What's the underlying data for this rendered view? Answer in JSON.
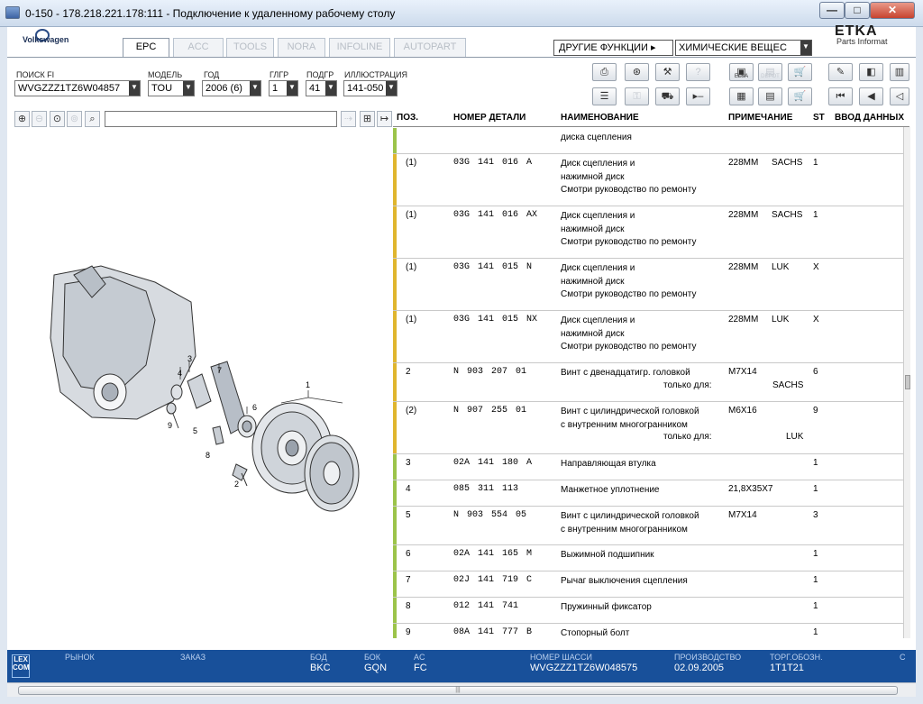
{
  "window": {
    "title": "0-150 - 178.218.221.178:111 - Подключение к удаленному рабочему столу",
    "minimize": "—",
    "maximize": "□",
    "close": "✕"
  },
  "brand": {
    "name": "Volkswagen",
    "etka": "ETKA",
    "etka_sub": "Parts Informat"
  },
  "tabs": [
    {
      "label": "EPC",
      "active": true
    },
    {
      "label": "ACC",
      "active": false
    },
    {
      "label": "TOOLS",
      "active": false
    },
    {
      "label": "NORA",
      "active": false
    },
    {
      "label": "INFOLINE",
      "active": false
    },
    {
      "label": "AUTOPART",
      "active": false
    }
  ],
  "functions": {
    "menu_label": "ДРУГИЕ ФУНКЦИИ ▸",
    "selected": "ХИМИЧЕСКИЕ ВЕЩЕС"
  },
  "filters": {
    "search_label": "ПОИСК FI",
    "search_value": "WVGZZZ1TZ6W04857",
    "model_label": "МОДЕЛЬ",
    "model_value": "TOU",
    "year_label": "ГОД",
    "year_value": "2006 (6)",
    "mgroup_label": "ГЛГР",
    "mgroup_value": "1",
    "subgroup_label": "ПОДГР",
    "subgroup_value": "41",
    "illustration_label": "ИЛЛЮСТРАЦИЯ",
    "illustration_value": "141-050"
  },
  "toolbar_icons": {
    "elsa": "ELSA",
    "depot": "DEPOT"
  },
  "illustration": {
    "callouts": [
      "1",
      "2",
      "3",
      "4",
      "5",
      "6",
      "7",
      "8",
      "9"
    ]
  },
  "table": {
    "headers": {
      "pos": "ПОЗ.",
      "part": "НОМЕР ДЕТАЛИ",
      "name": "НАИМЕНОВАНИЕ",
      "note": "ПРИМЕЧАНИЕ",
      "st": "ST",
      "input": "ВВОД ДАННЫХ"
    },
    "rows": [
      {
        "pos": "",
        "part": "",
        "name": [
          "диска сцепления"
        ],
        "note": "",
        "note2": "",
        "st": "",
        "bar": "#9cc44a",
        "h": 29
      },
      {
        "pos": "(1)",
        "part": "03G 141 016 A",
        "name": [
          "Диск сцепления и",
          "нажимной диск",
          "Смотри руководство по ремонту"
        ],
        "note": "228MM",
        "note2": "SACHS",
        "st": "1",
        "bar": "#e0b62e",
        "h": 58
      },
      {
        "pos": "(1)",
        "part": "03G 141 016 AX",
        "name": [
          "Диск сцепления и",
          "нажимной диск",
          "Смотри руководство по ремонту"
        ],
        "note": "228MM",
        "note2": "SACHS",
        "st": "1",
        "bar": "#e0b62e",
        "h": 58
      },
      {
        "pos": "(1)",
        "part": "03G 141 015 N",
        "name": [
          "Диск сцепления и",
          "нажимной диск",
          "Смотри руководство по ремонту"
        ],
        "note": "228MM",
        "note2": "LUK",
        "st": "X",
        "bar": "#e0b62e",
        "h": 58
      },
      {
        "pos": "(1)",
        "part": "03G 141 015 NX",
        "name": [
          "Диск сцепления и",
          "нажимной диск",
          "Смотри руководство по ремонту"
        ],
        "note": "228MM",
        "note2": "LUK",
        "st": "X",
        "bar": "#e0b62e",
        "h": 58
      },
      {
        "pos": "2",
        "part": "N 903 207 01",
        "name": [
          "Винт с двенадцатигр. головкой"
        ],
        "sub_label": "только для:",
        "sub_value": "SACHS",
        "note": "M7X14",
        "note2": "",
        "st": "6",
        "bar": "#e0b62e",
        "h": 43
      },
      {
        "pos": "(2)",
        "part": "N 907 255 01",
        "name": [
          "Винт с цилиндрической головкой",
          "с внутренним многогранником"
        ],
        "sub_label": "только для:",
        "sub_value": "LUK",
        "note": "M6X16",
        "note2": "",
        "st": "9",
        "bar": "#e0b62e",
        "h": 58
      },
      {
        "pos": "3",
        "part": "02A 141 180 A",
        "name": [
          "Направляющая втулка"
        ],
        "note": "",
        "note2": "",
        "st": "1",
        "bar": "#9cc44a",
        "h": 29
      },
      {
        "pos": "4",
        "part": "085 311 113",
        "name": [
          "Манжетное уплотнение"
        ],
        "note": "21,8X35X7",
        "note2": "",
        "st": "1",
        "bar": "#9cc44a",
        "h": 29
      },
      {
        "pos": "5",
        "part": "N 903 554 05",
        "name": [
          "Винт с цилиндрической головкой",
          "с внутренним многогранником"
        ],
        "note": "M7X14",
        "note2": "",
        "st": "3",
        "bar": "#9cc44a",
        "h": 43
      },
      {
        "pos": "6",
        "part": "02A 141 165 M",
        "name": [
          "Выжимной подшипник"
        ],
        "note": "",
        "note2": "",
        "st": "1",
        "bar": "#9cc44a",
        "h": 29
      },
      {
        "pos": "7",
        "part": "02J 141 719 C",
        "name": [
          "Рычаг выключения сцепления"
        ],
        "note": "",
        "note2": "",
        "st": "1",
        "bar": "#9cc44a",
        "h": 29
      },
      {
        "pos": "8",
        "part": "012 141 741",
        "name": [
          "Пружинный фиксатор"
        ],
        "note": "",
        "note2": "",
        "st": "1",
        "bar": "#9cc44a",
        "h": 29
      },
      {
        "pos": "9",
        "part": "08A 141 777 B",
        "name": [
          "Стопорный болт"
        ],
        "note": "",
        "note2": "",
        "st": "1",
        "bar": "#9cc44a",
        "h": 29
      }
    ]
  },
  "status": {
    "logo": "LEX\nCOM",
    "market_label": "РЫНОК",
    "market_value": "",
    "order_label": "ЗАКАЗ",
    "order_value": "",
    "bod_label": "БОД",
    "bod_value": "BKC",
    "bok_label": "БОК",
    "bok_value": "GQN",
    "ac_label": "AC",
    "ac_value": "FC",
    "chassis_label": "НОМЕР ШАССИ",
    "chassis_value": "WVGZZZ1TZ6W048575",
    "production_label": "ПРОИЗВОДСТВО",
    "production_value": "02.09.2005",
    "trade_label": "ТОРГ.ОБОЗН.",
    "trade_value": "1T1T21",
    "extra_label": "С"
  },
  "scroll": {
    "grip": "|||"
  }
}
